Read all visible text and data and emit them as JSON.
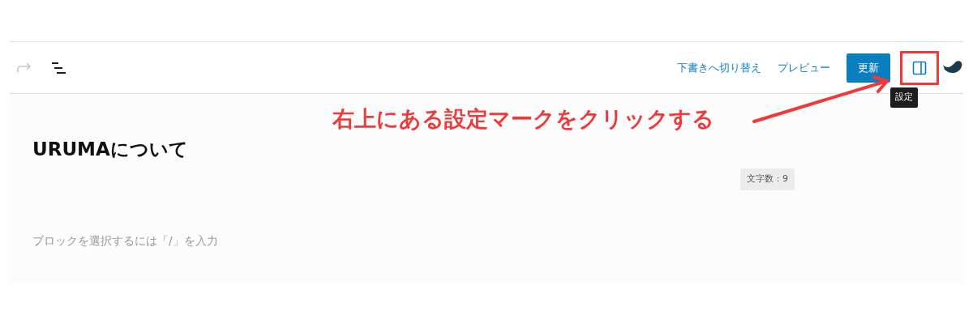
{
  "toolbar": {
    "links": [
      "下書きへ切り替え",
      "プレビュー"
    ],
    "update_button": "更新",
    "settings_tooltip": "設定"
  },
  "annotation": {
    "text": "右上にある設定マークをクリックする"
  },
  "editor": {
    "title": "URUMAについて",
    "word_count": "文字数 : 9",
    "placeholder": "ブロックを選択するには「/」を入力"
  }
}
